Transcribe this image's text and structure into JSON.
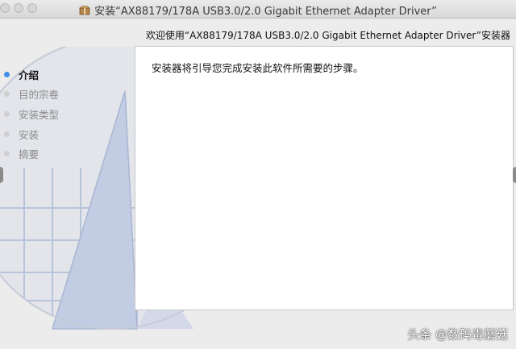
{
  "window": {
    "title": "安装“AX88179/178A USB3.0/2.0 Gigabit Ethernet Adapter Driver”"
  },
  "header": {
    "welcome": "欢迎使用“AX88179/178A USB3.0/2.0 Gigabit Ethernet Adapter Driver”安装器"
  },
  "sidebar": {
    "steps": [
      {
        "label": "介绍",
        "active": true
      },
      {
        "label": "目的宗卷",
        "active": false
      },
      {
        "label": "安装类型",
        "active": false
      },
      {
        "label": "安装",
        "active": false
      },
      {
        "label": "摘要",
        "active": false
      }
    ]
  },
  "content": {
    "intro": "安装器将引导您完成安装此软件所需要的步骤。"
  },
  "watermark": {
    "text": "头条 @数码毒蘑菇"
  },
  "colors": {
    "active_step": "#3f8ee8",
    "inactive_step": "#cfcfcf",
    "art": "#b8c4da"
  }
}
